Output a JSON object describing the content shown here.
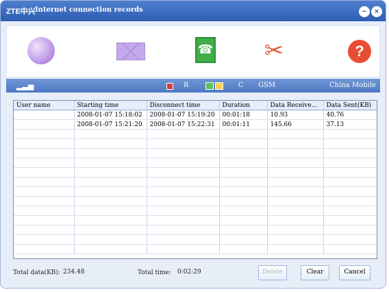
{
  "titlebar": {
    "brand": "ZTE中兴",
    "title": "Internet connection records",
    "minimize_icon": "minimize-icon",
    "close_icon": "close-icon"
  },
  "toolbar": {
    "icons": [
      "globe-icon",
      "envelope-icon",
      "phonebook-icon",
      "tools-icon",
      "help-icon"
    ]
  },
  "statusbar": {
    "signal_icon": "signal-icon",
    "roaming": "R",
    "connection": "C",
    "network": "GSM",
    "operator": "China Mobile"
  },
  "table": {
    "columns": [
      "User name",
      "Starting time",
      "Disconnect time",
      "Duration",
      "Data Received(...",
      "Data Sent(KB)"
    ],
    "rows": [
      [
        "",
        "2008-01-07  15:18:02",
        "2008-01-07  15:19:20",
        "00:01:18",
        "10.93",
        "40.76"
      ],
      [
        "",
        "2008-01-07  15:21:20",
        "2008-01-07  15:22:31",
        "00:01:11",
        "145.66",
        "37.13"
      ]
    ]
  },
  "footer": {
    "total_data_label": "Total data(KB):",
    "total_data_value": "234.48",
    "total_time_label": "Total time:",
    "total_time_value": "0:02:29",
    "delete_label": "Delete",
    "clear_label": "Clear",
    "cancel_label": "Cancel"
  }
}
